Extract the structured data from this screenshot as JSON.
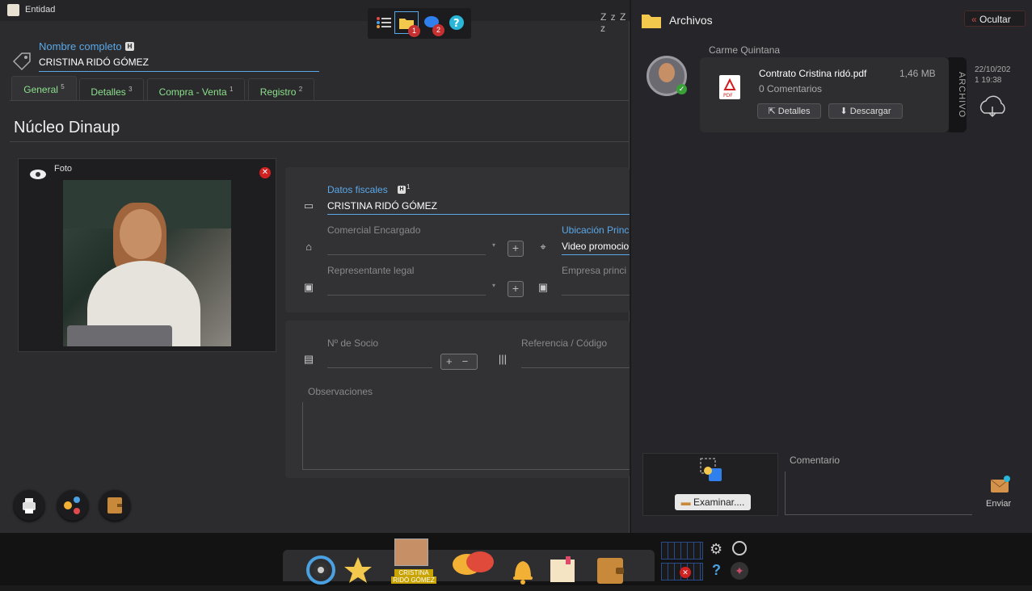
{
  "window": {
    "title": "Entidad"
  },
  "toolbar": {
    "badge_files": "1",
    "badge_chat": "2",
    "sleep_label": "Z z Z z"
  },
  "name_field": {
    "label": "Nombre completo",
    "value": "CRISTINA RIDÓ GÓMEZ"
  },
  "tabs": [
    {
      "label": "General",
      "count": "5"
    },
    {
      "label": "Detalles",
      "count": "3"
    },
    {
      "label": "Compra - Venta",
      "count": "1"
    },
    {
      "label": "Registro",
      "count": "2"
    }
  ],
  "section_title": "Núcleo Dinaup",
  "photo": {
    "label": "Foto"
  },
  "fiscal": {
    "label": "Datos fiscales",
    "sup": "1",
    "value": "CRISTINA RIDÓ GÓMEZ",
    "comercial_label": "Comercial Encargado",
    "ubicacion_label": "Ubicación Princ",
    "ubicacion_value": "Video promocio",
    "representante_label": "Representante legal",
    "empresa_label": "Empresa princi"
  },
  "socio": {
    "socio_label": "Nº de Socio",
    "referencia_label": "Referencia / Código",
    "observaciones_label": "Observaciones"
  },
  "archivos": {
    "title": "Archivos",
    "hide_label": "Ocultar",
    "user": "Carme Quintana",
    "file_name": "Contrato Cristina ridó.pdf",
    "file_size": "1,46 MB",
    "comments": "0 Comentarios",
    "details_btn": "Detalles",
    "download_btn": "Descargar",
    "strip_label": "ARCHIVO",
    "date": "22/10/202",
    "time": "1 19:38",
    "examinar_btn": "Examinar....",
    "comment_label": "Comentario",
    "send_label": "Enviar"
  },
  "taskbar": {
    "user_name_1": "CRISTINA",
    "user_name_2": "RIDÓ GÓMEZ"
  },
  "colors": {
    "accent_blue": "#5aa8e8",
    "tab_green": "#8be08b",
    "badge_red": "#c73030"
  }
}
